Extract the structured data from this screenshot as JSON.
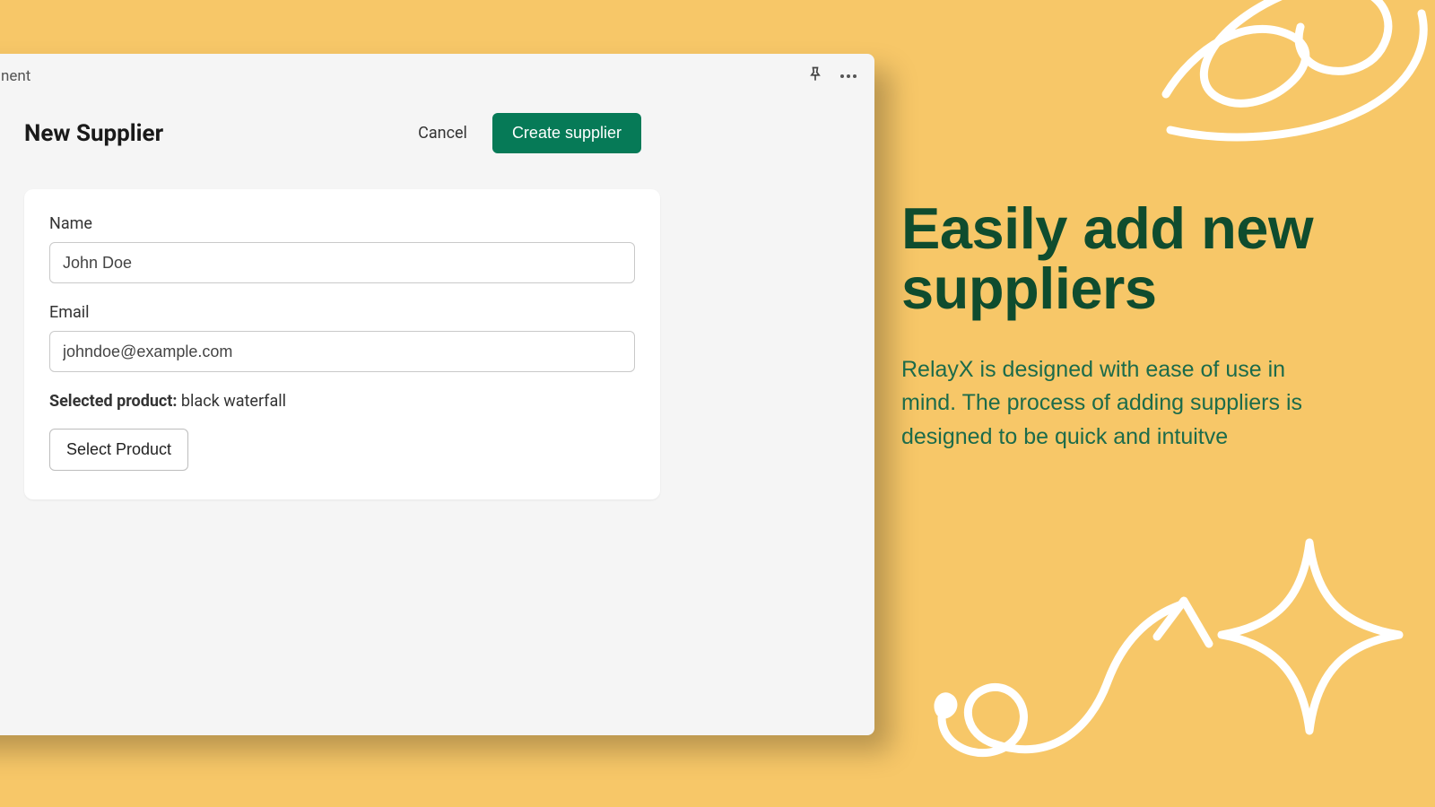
{
  "app": {
    "header_title_fragment": "nent"
  },
  "page": {
    "title": "New Supplier",
    "cancel_label": "Cancel",
    "create_label": "Create supplier"
  },
  "form": {
    "name_label": "Name",
    "name_value": "John Doe",
    "email_label": "Email",
    "email_value": "johndoe@example.com",
    "selected_product_label": "Selected product:",
    "selected_product_value": " black waterfall",
    "select_product_button": "Select Product"
  },
  "marketing": {
    "heading": "Easily add new suppliers",
    "body": "RelayX is designed with ease of use in mind. The process of adding suppliers is designed to be quick and intuitve"
  }
}
